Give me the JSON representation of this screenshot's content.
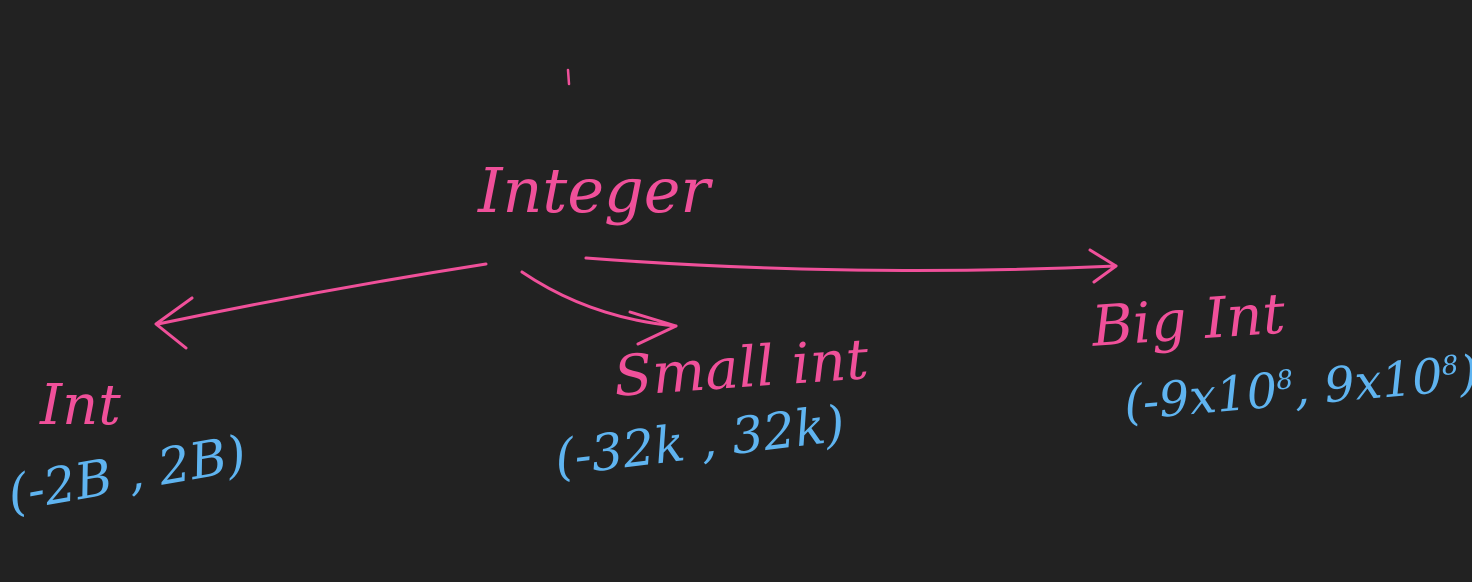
{
  "colors": {
    "background": "#222222",
    "category": "#f0509a",
    "range": "#5fb4f0"
  },
  "root": {
    "label": "Integer"
  },
  "types": [
    {
      "name": "Int",
      "range": "(-2B , 2B)"
    },
    {
      "name": "Small int",
      "range": "(-32k , 32k)"
    },
    {
      "name": "Big Int",
      "range": {
        "open": "(-9x10",
        "exp1": "8",
        "mid": ", 9x10",
        "exp2": "8",
        "close": ")"
      }
    }
  ]
}
